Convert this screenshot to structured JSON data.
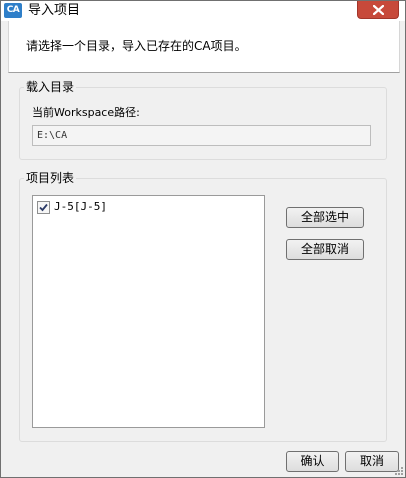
{
  "window": {
    "title": "导入项目",
    "icon_text": "CA",
    "close_icon": "close-icon"
  },
  "header": {
    "instruction": "请选择一个目录，导入已存在的CA项目。"
  },
  "load_directory": {
    "group_label": "载入目录",
    "path_label": "当前Workspace路径:",
    "path_value": "E:\\CA"
  },
  "project_list": {
    "group_label": "项目列表",
    "items": [
      {
        "label": "J-5[J-5]",
        "checked": true
      }
    ],
    "select_all_label": "全部选中",
    "deselect_all_label": "全部取消"
  },
  "footer": {
    "ok_label": "确认",
    "cancel_label": "取消"
  },
  "colors": {
    "close_button": "#c7493a",
    "app_icon": "#2f7fc9",
    "dialog_bg": "#f0f0f0"
  }
}
